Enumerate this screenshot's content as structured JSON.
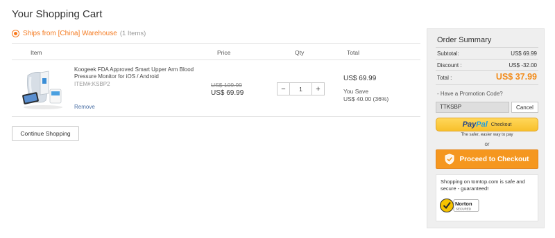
{
  "page": {
    "title": "Your Shopping Cart"
  },
  "warehouse": {
    "label": "Ships from [China] Warehouse",
    "count": "(1 Items)"
  },
  "table": {
    "headers": {
      "item": "Item",
      "price": "Price",
      "qty": "Qty",
      "total": "Total"
    }
  },
  "item": {
    "name": "Koogeek FDA Approved Smart Upper Arm Blood Pressure Monitor for iOS / Android",
    "item_no": "ITEM#:KSBP2",
    "remove": "Remove",
    "old_price": "US$ 109.99",
    "price": "US$ 69.99",
    "qty": "1",
    "minus": "−",
    "plus": "+",
    "total": "US$ 69.99",
    "you_save": "You Save",
    "save_amount": "US$ 40.00 (36%)"
  },
  "actions": {
    "continue": "Continue Shopping"
  },
  "summary": {
    "title": "Order Summary",
    "subtotal_label": "Subtotal:",
    "subtotal": "US$ 69.99",
    "discount_label": "Discount :",
    "discount": "US$ -32.00",
    "total_label": "Total :",
    "total": "US$ 37.99",
    "promo_label": "- Have a Promotion Code?",
    "promo_code": "TTKSBP",
    "cancel": "Cancel",
    "paypal_pay": "Pay",
    "paypal_pal": "Pal",
    "paypal_checkout": "Checkout",
    "paypal_tagline": "The safer, easier way to pay",
    "or": "or",
    "proceed": "Proceed to Checkout",
    "secure_text": "Shopping on tomtop.com is safe and secure - guaranteed!",
    "norton_name": "Norton",
    "norton_sub": "SECURED"
  },
  "colors": {
    "accent": "#f47a20",
    "proceed": "#f5971f",
    "paypal": "#f8c02c",
    "link": "#4a6fa5"
  },
  "icons": [
    "radio-selected-icon",
    "shield-check-icon",
    "norton-check-icon"
  ]
}
